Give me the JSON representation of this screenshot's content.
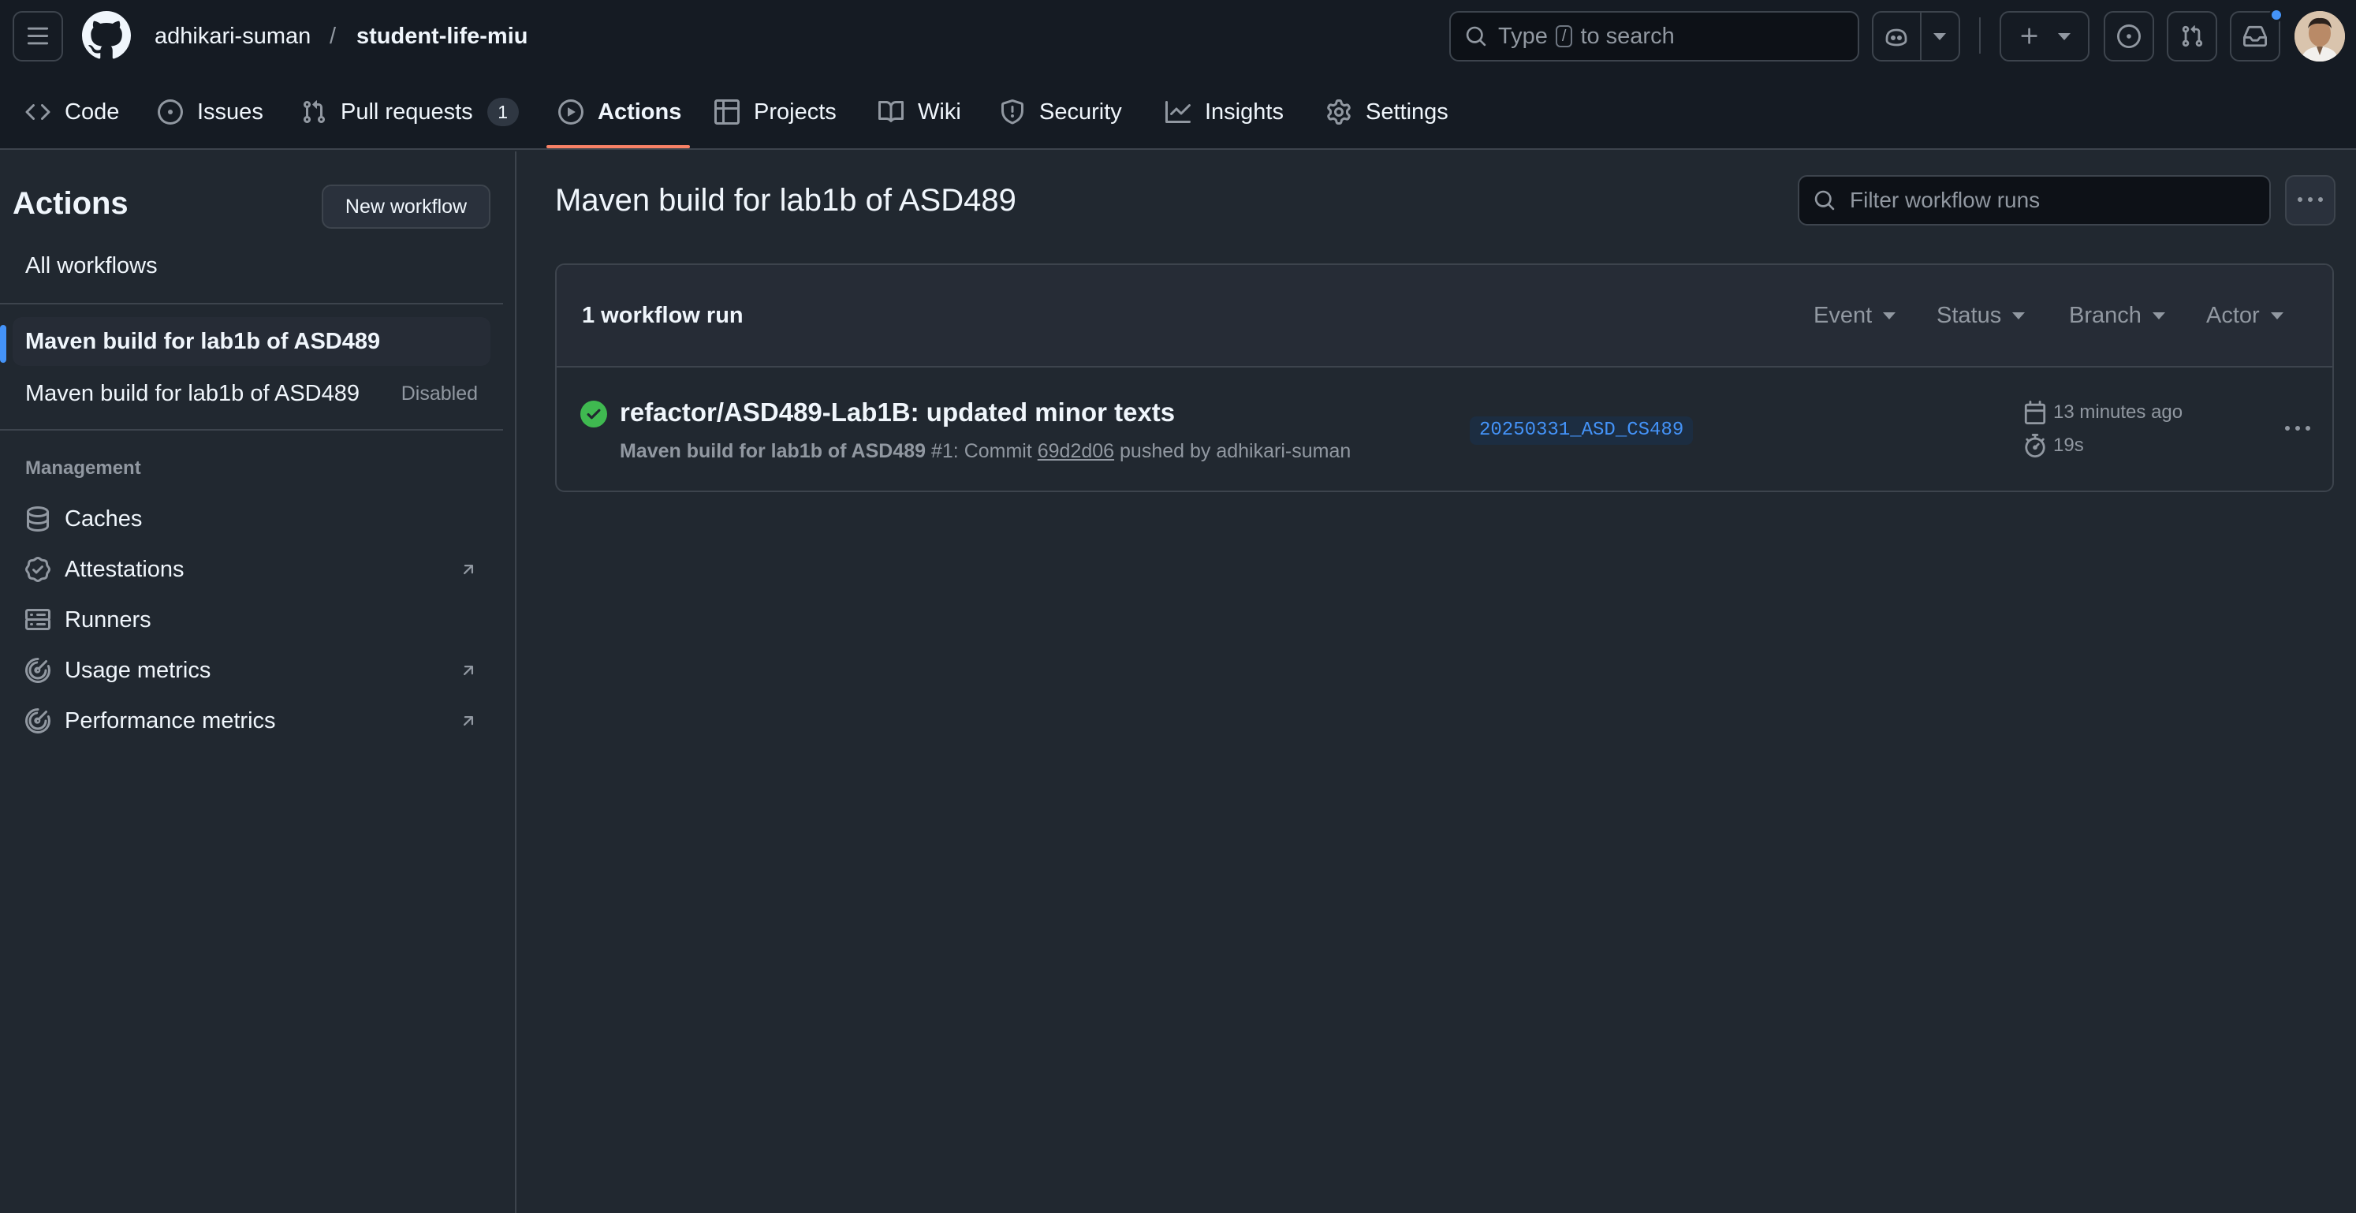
{
  "header": {
    "owner": "adhikari-suman",
    "separator": "/",
    "repo": "student-life-miu",
    "search_prefix": "Type",
    "search_key": "/",
    "search_suffix": "to search"
  },
  "repo_nav": [
    {
      "label": "Code",
      "icon": "code-icon"
    },
    {
      "label": "Issues",
      "icon": "issue-opened-icon"
    },
    {
      "label": "Pull requests",
      "icon": "git-pull-request-icon",
      "counter": "1"
    },
    {
      "label": "Actions",
      "icon": "play-icon",
      "active": true
    },
    {
      "label": "Projects",
      "icon": "table-icon"
    },
    {
      "label": "Wiki",
      "icon": "book-icon"
    },
    {
      "label": "Security",
      "icon": "shield-icon"
    },
    {
      "label": "Insights",
      "icon": "graph-icon"
    },
    {
      "label": "Settings",
      "icon": "gear-icon"
    }
  ],
  "sidebar": {
    "title": "Actions",
    "new_workflow": "New workflow",
    "all_workflows": "All workflows",
    "workflows": [
      {
        "label": "Maven build for lab1b of ASD489",
        "selected": true
      },
      {
        "label": "Maven build for lab1b of ASD489",
        "tag": "Disabled"
      }
    ],
    "management_label": "Management",
    "management": [
      {
        "label": "Caches",
        "icon": "database-icon",
        "external": false
      },
      {
        "label": "Attestations",
        "icon": "verified-icon",
        "external": true
      },
      {
        "label": "Runners",
        "icon": "server-icon",
        "external": false
      },
      {
        "label": "Usage metrics",
        "icon": "meter-icon",
        "external": true
      },
      {
        "label": "Performance metrics",
        "icon": "meter-icon",
        "external": true
      }
    ]
  },
  "main": {
    "title": "Maven build for lab1b of ASD489",
    "filter_placeholder": "Filter workflow runs",
    "runs_count": "1 workflow run",
    "filters": [
      "Event",
      "Status",
      "Branch",
      "Actor"
    ],
    "run": {
      "status": "success",
      "title": "refactor/ASD489-Lab1B: updated minor texts",
      "workflow": "Maven build for lab1b of ASD489",
      "run_number": "#1",
      "commit_prefix": ": Commit",
      "sha": "69d2d06",
      "pushed_by": "pushed by adhikari-suman",
      "branch": "20250331_ASD_CS489",
      "time_ago": "13 minutes ago",
      "duration": "19s"
    }
  },
  "colors": {
    "background": "#212830",
    "header": "#151b23",
    "border": "#3d444d",
    "accent_tab": "#f78166",
    "success": "#3fb950",
    "link": "#4493f8",
    "notification_dot": "#4493f8"
  }
}
